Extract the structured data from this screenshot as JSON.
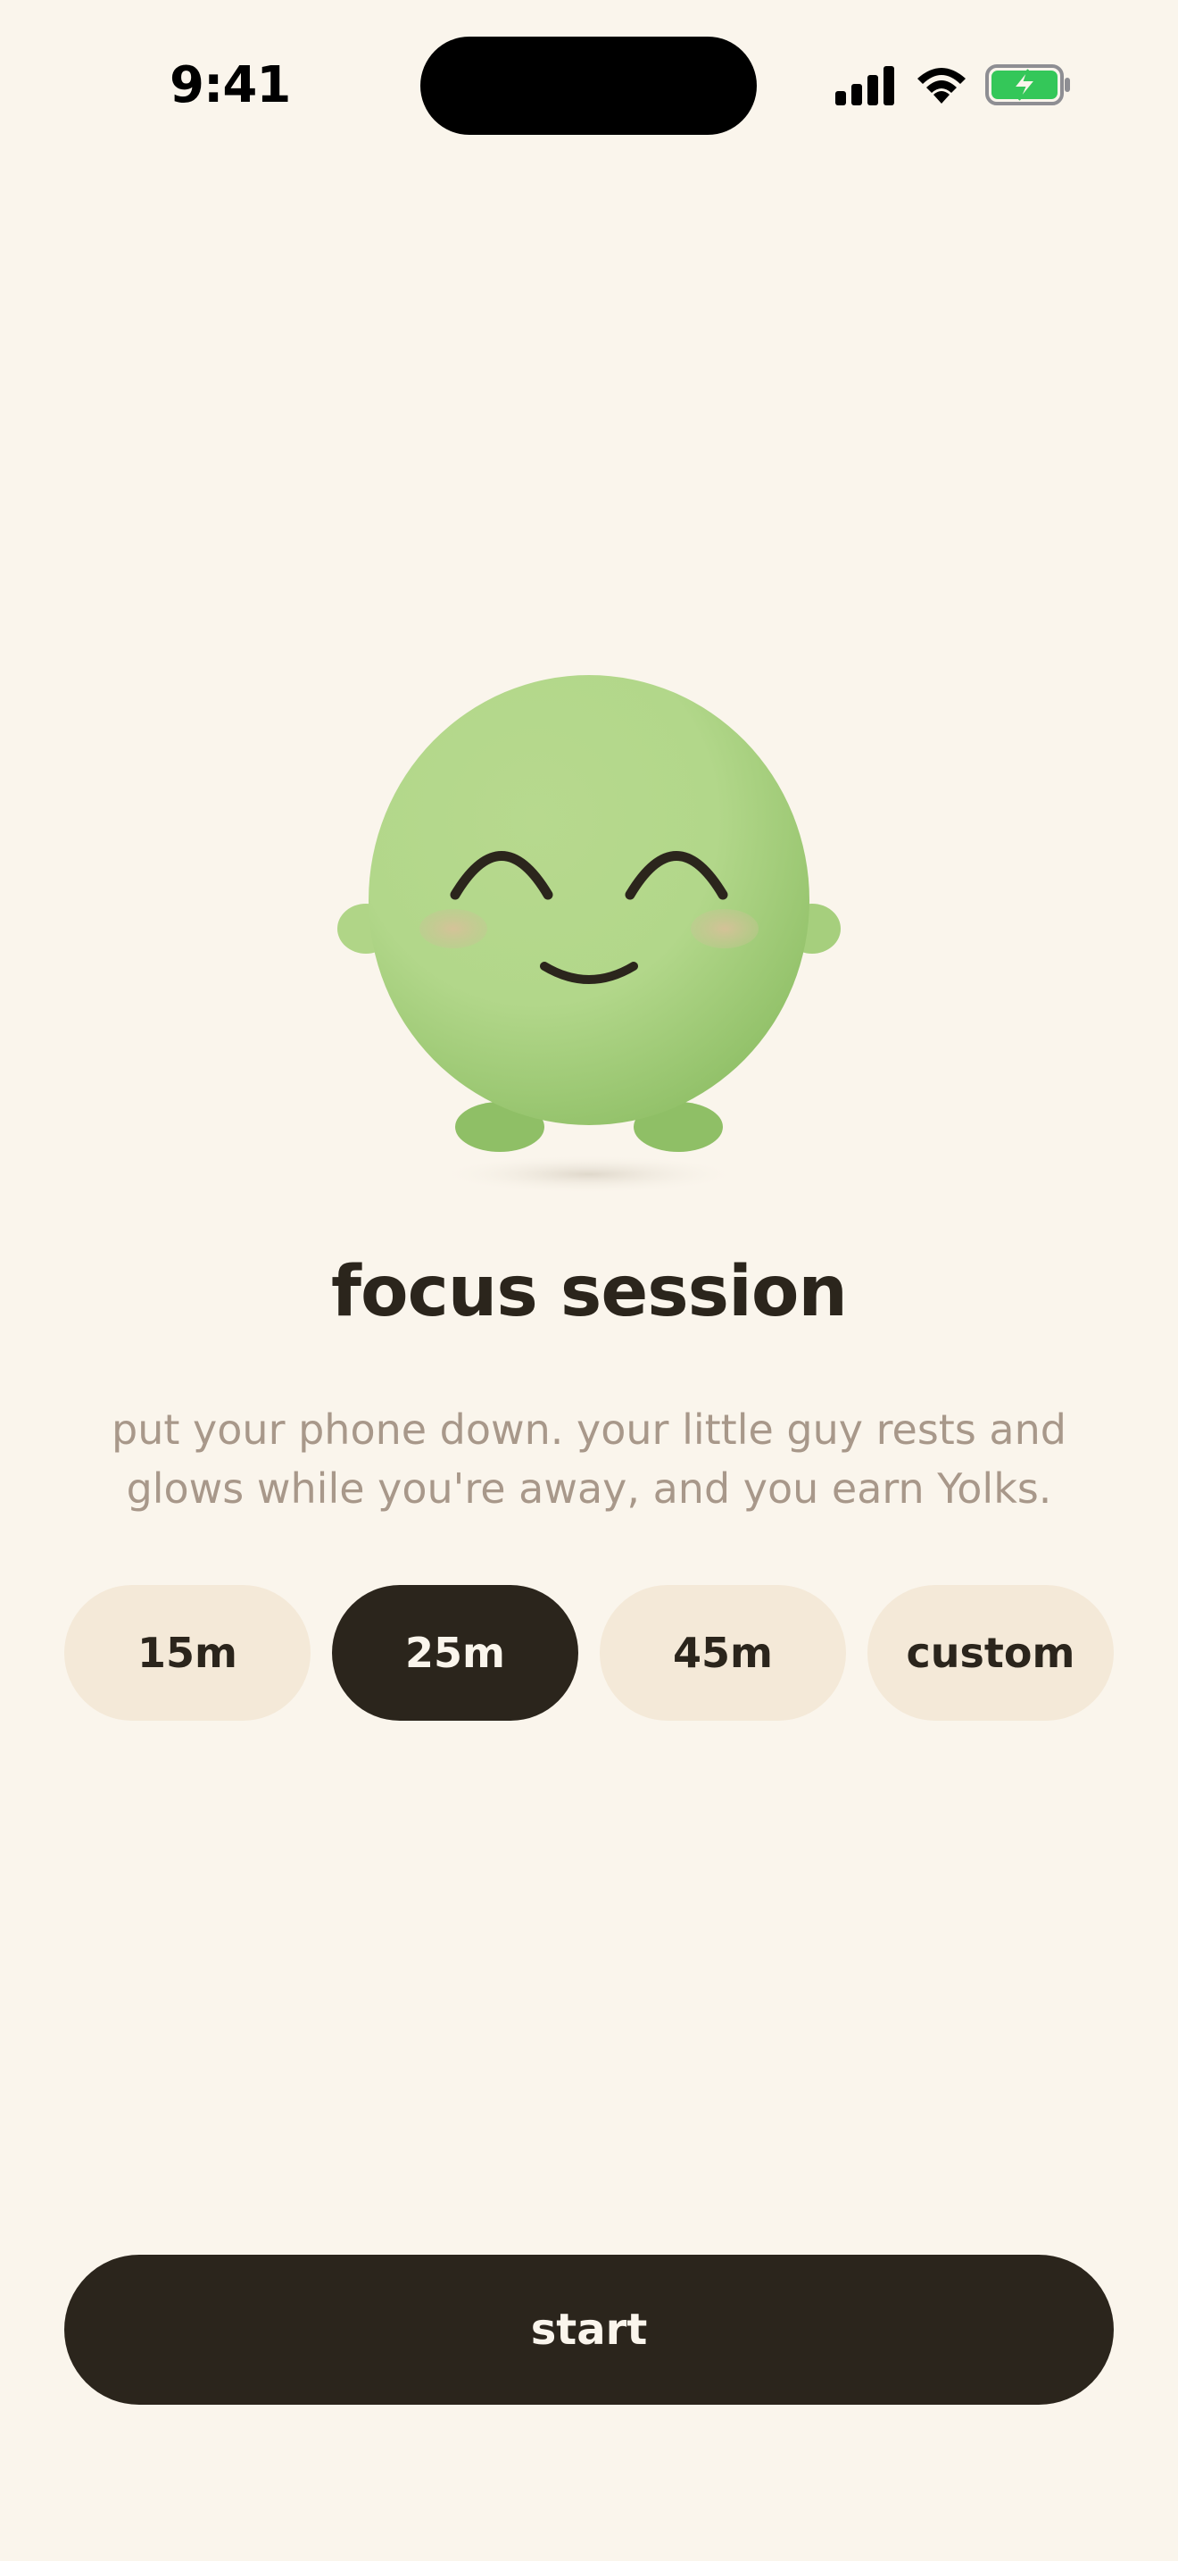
{
  "status_bar": {
    "time": "9:41",
    "icons": [
      "cellular-signal-icon",
      "wifi-icon",
      "battery-charging-icon"
    ],
    "battery_color": "#34c759"
  },
  "mascot": {
    "name": "little-guy-mascot",
    "expression": "happy-closed-eyes",
    "body_color": "#a9d486",
    "cheek_color": "#d9c09a"
  },
  "main": {
    "title": "focus session",
    "description": "put your phone down. your little guy rests and glows while you're away, and you earn Yolks."
  },
  "durations": {
    "options": [
      {
        "label": "15m",
        "selected": false
      },
      {
        "label": "25m",
        "selected": true
      },
      {
        "label": "45m",
        "selected": false
      },
      {
        "label": "custom",
        "selected": false
      }
    ]
  },
  "actions": {
    "start_label": "start"
  },
  "colors": {
    "background": "#faf5ec",
    "dark": "#2b251c",
    "chip": "#f4e9d8",
    "muted_text": "#a8988a"
  }
}
